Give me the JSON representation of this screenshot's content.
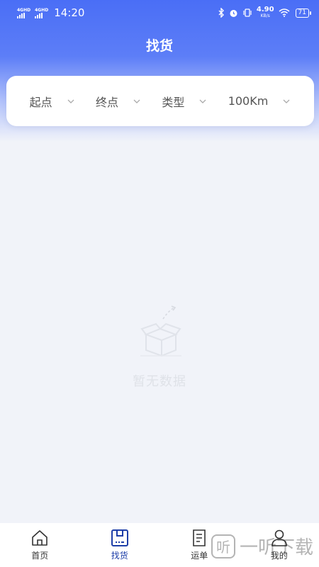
{
  "status_bar": {
    "sim1": "4GHD",
    "sim2": "4GHD",
    "time": "14:20",
    "net_speed": "4.90",
    "net_unit": "KB/s",
    "battery": "71"
  },
  "header": {
    "title": "找货"
  },
  "filters": [
    {
      "label": "起点"
    },
    {
      "label": "终点"
    },
    {
      "label": "类型"
    },
    {
      "label": "100Km"
    }
  ],
  "empty_state": {
    "text": "暂无数据"
  },
  "tabbar": {
    "items": [
      {
        "label": "首页",
        "icon": "home-icon",
        "active": false
      },
      {
        "label": "找货",
        "icon": "cargo-box-icon",
        "active": true
      },
      {
        "label": "运单",
        "icon": "document-icon",
        "active": false
      },
      {
        "label": "我的",
        "icon": "profile-icon",
        "active": false
      }
    ]
  },
  "watermark": {
    "text": "一听下载",
    "logo": "听"
  },
  "colors": {
    "primary": "#4a6ef6",
    "active_tab": "#1d3ea8",
    "background": "#f1f3f9"
  }
}
